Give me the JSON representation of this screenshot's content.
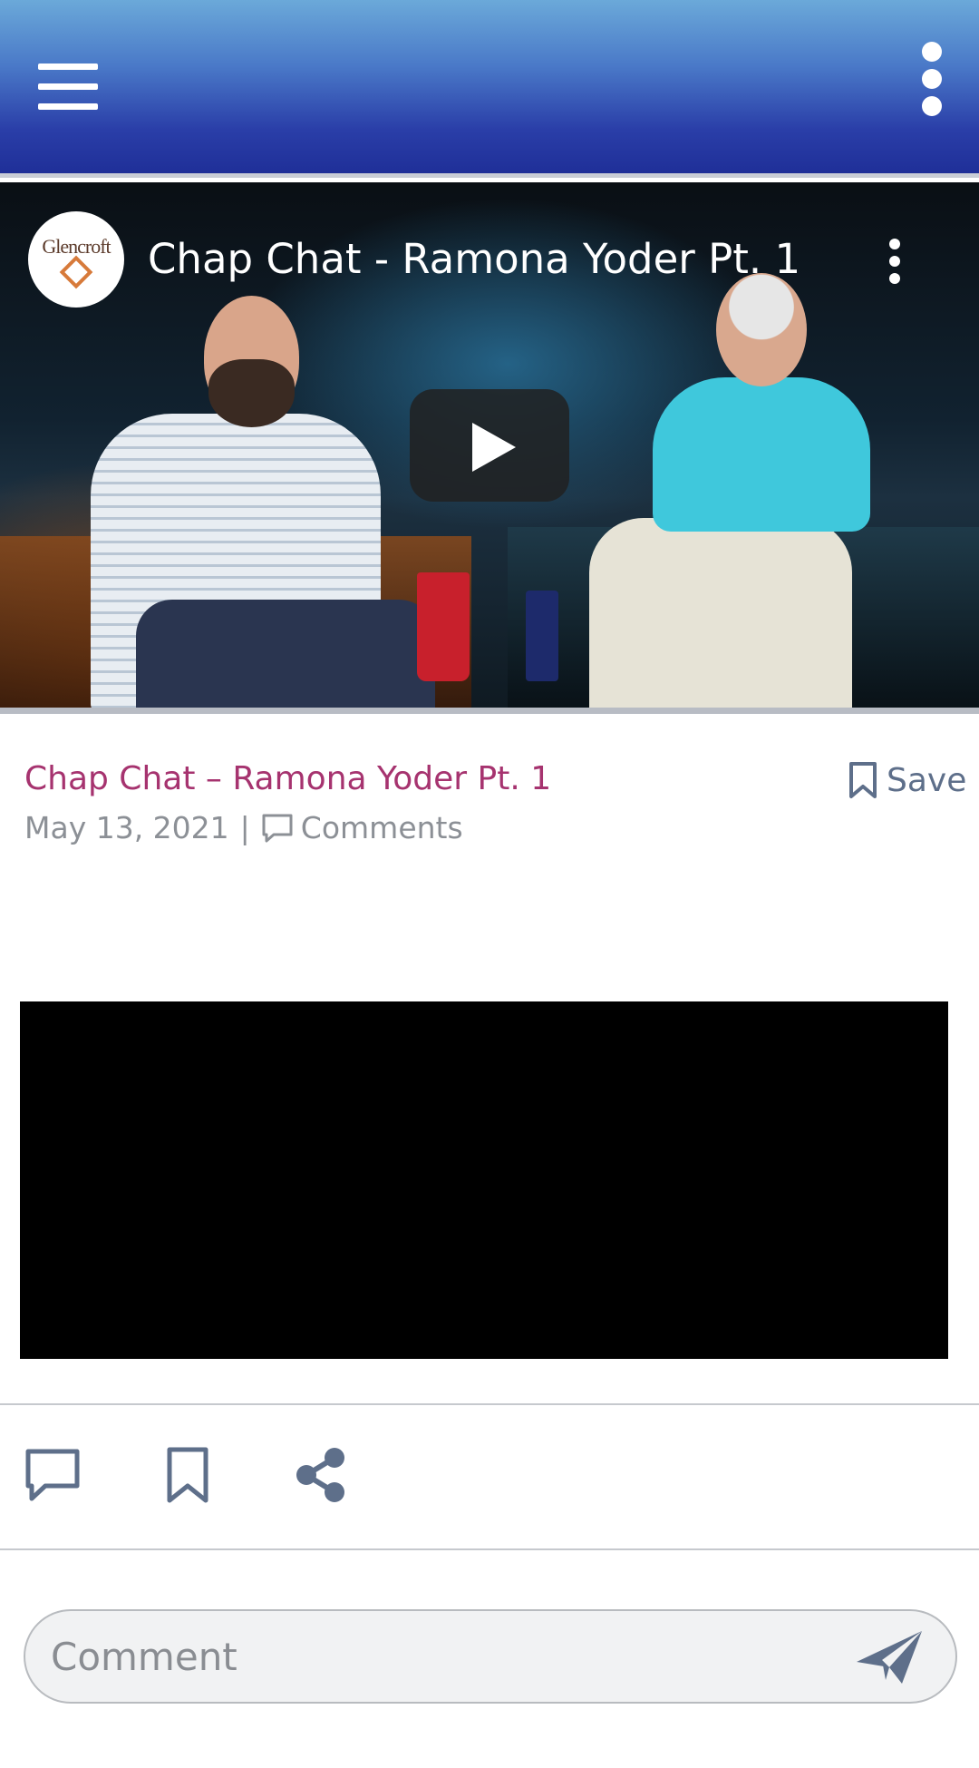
{
  "app_bar": {
    "menu_icon": "hamburger-menu-icon",
    "overflow_icon": "more-vertical-icon"
  },
  "video": {
    "channel_logo_text": "Glencroft",
    "title": "Chap Chat - Ramona Yoder Pt. 1",
    "play_icon": "play-icon",
    "more_icon": "more-vertical-icon"
  },
  "post": {
    "title": "Chap Chat – Ramona Yoder Pt. 1",
    "save_label": "Save",
    "date": "May 13, 2021",
    "separator": "|",
    "comments_label": "Comments"
  },
  "actions": [
    {
      "name": "comment",
      "icon": "comment-icon"
    },
    {
      "name": "bookmark",
      "icon": "bookmark-icon"
    },
    {
      "name": "share",
      "icon": "share-icon"
    }
  ],
  "comment_bar": {
    "placeholder": "Comment",
    "value": "",
    "send_icon": "send-icon"
  },
  "colors": {
    "appbar_top": "#6ba9d9",
    "appbar_bottom": "#1f2f98",
    "title_accent": "#a6336f",
    "icon_gray": "#5e6f8a"
  }
}
